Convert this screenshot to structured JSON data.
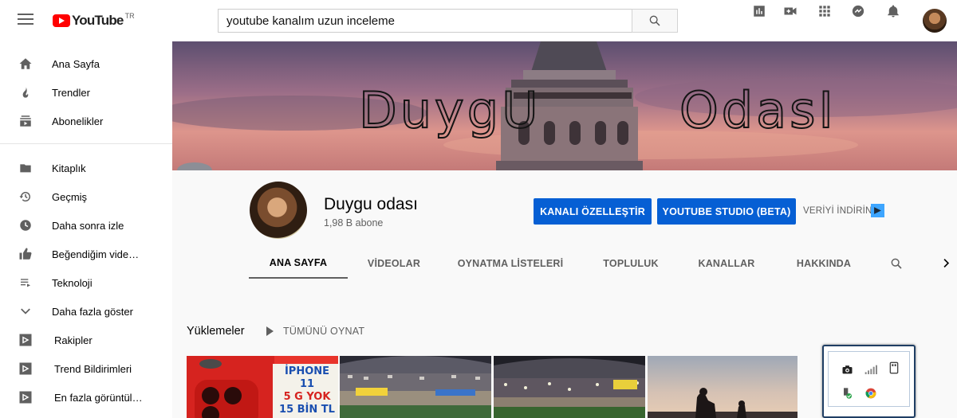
{
  "topbar": {
    "logo_text": "YouTube",
    "logo_country": "TR",
    "search_value": "youtube kanalım uzun inceleme",
    "icons": [
      "analytics-icon",
      "create-video-icon",
      "apps-grid-icon",
      "messages-icon",
      "notifications-bell-icon"
    ]
  },
  "sidebar": {
    "items": [
      {
        "label": "Ana Sayfa",
        "icon": "home-icon"
      },
      {
        "label": "Trendler",
        "icon": "fire-icon"
      },
      {
        "label": "Abonelikler",
        "icon": "subscriptions-icon"
      },
      {
        "label": "Kitaplık",
        "icon": "folder-icon"
      },
      {
        "label": "Geçmiş",
        "icon": "history-icon"
      },
      {
        "label": "Daha sonra izle",
        "icon": "clock-icon"
      },
      {
        "label": "Beğendiğim vide…",
        "icon": "thumbs-up-icon"
      },
      {
        "label": "Teknoloji",
        "icon": "playlist-icon"
      },
      {
        "label": "Daha fazla göster",
        "icon": "chevron-down-icon"
      },
      {
        "label": "Rakipler",
        "icon": "playlist-play-icon"
      },
      {
        "label": "Trend Bildirimleri",
        "icon": "playlist-play-icon"
      },
      {
        "label": "En fazla görüntül…",
        "icon": "playlist-play-icon"
      }
    ]
  },
  "banner": {
    "left_text": "DuygU",
    "right_text": "OdasI"
  },
  "channel": {
    "name": "Duygu odası",
    "subscribers": "1,98 B abone",
    "customize_label": "KANALI ÖZELLEŞTİR",
    "studio_label": "YOUTUBE STUDIO (BETA)",
    "download_label": "VERİYİ İNDİRİN",
    "accent": "#065fd4"
  },
  "tabs": [
    {
      "label": "ANA SAYFA",
      "active": true
    },
    {
      "label": "VİDEOLAR",
      "active": false
    },
    {
      "label": "OYNATMA LİSTELERİ",
      "active": false
    },
    {
      "label": "TOPLULUK",
      "active": false
    },
    {
      "label": "KANALLAR",
      "active": false
    },
    {
      "label": "HAKKINDA",
      "active": false
    }
  ],
  "uploads": {
    "title": "Yüklemeler",
    "play_all": "TÜMÜNÜ OYNAT",
    "thumb1_text": [
      "İPHONE 11",
      "5 G YOK",
      "15 BİN TL"
    ]
  }
}
